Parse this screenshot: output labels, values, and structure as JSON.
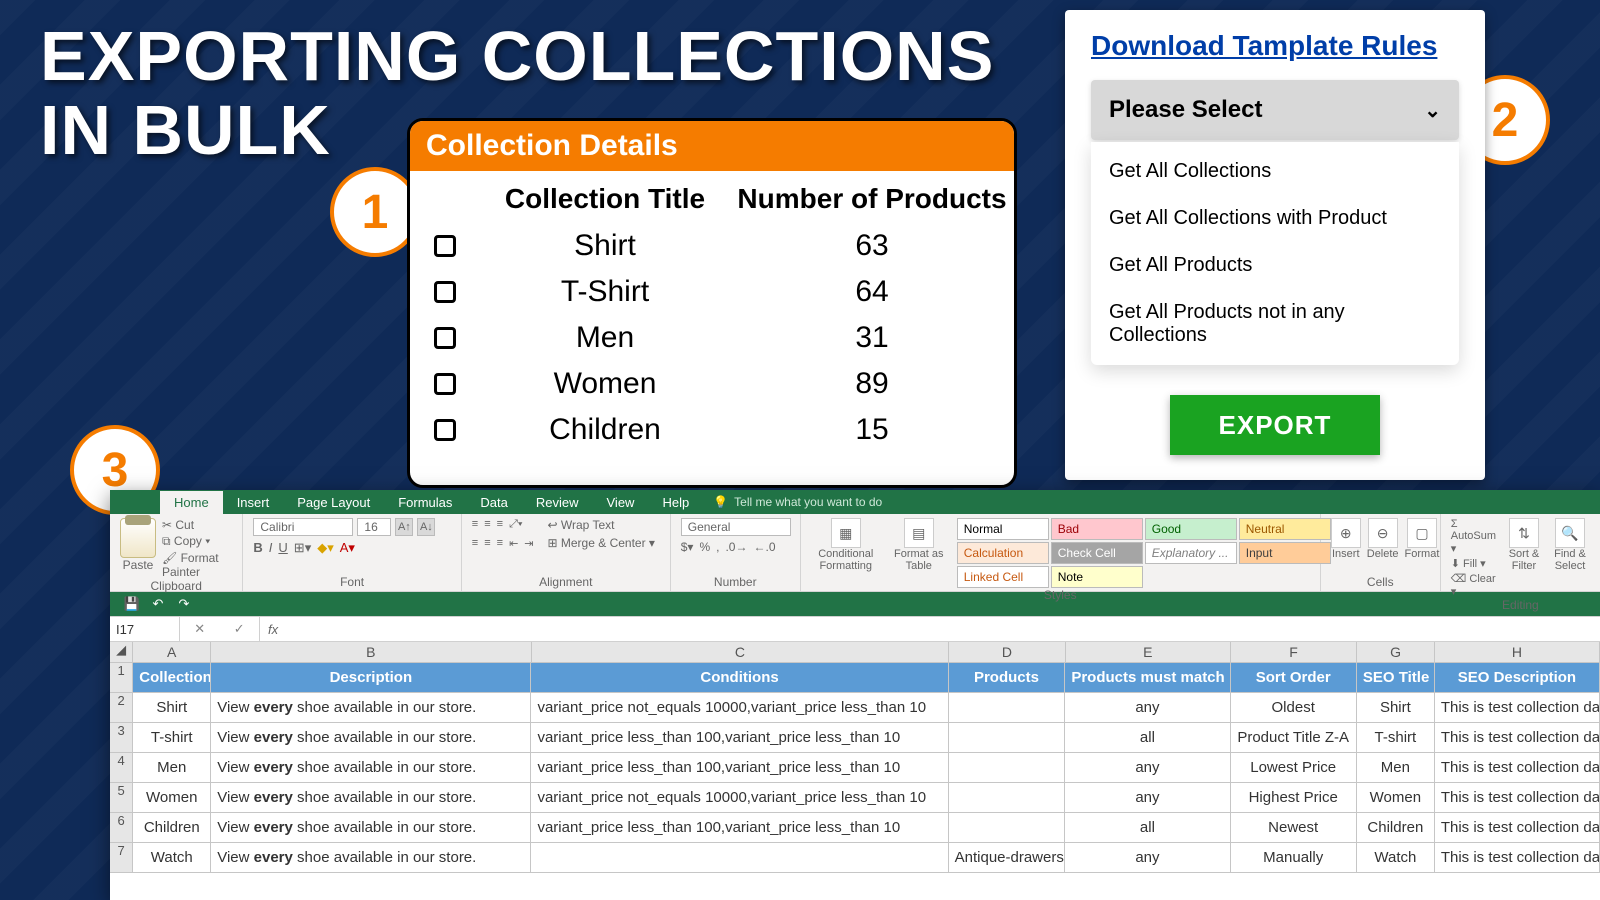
{
  "headline_l1": "EXPORTING COLLECTIONS",
  "headline_l2": "IN BULK",
  "badges": {
    "b1": "1",
    "b2": "2",
    "b3": "3"
  },
  "collection_card": {
    "title": "Collection Details",
    "col_title": "Collection Title",
    "col_count": "Number of Products",
    "rows": [
      {
        "title": "Shirt",
        "count": "63"
      },
      {
        "title": "T-Shirt",
        "count": "64"
      },
      {
        "title": "Men",
        "count": "31"
      },
      {
        "title": "Women",
        "count": "89"
      },
      {
        "title": "Children",
        "count": "15"
      }
    ]
  },
  "export_panel": {
    "download_link": "Download Tamplate Rules",
    "select_placeholder": "Please Select",
    "options": [
      "Get All Collections",
      "Get All Collections with Product",
      "Get All Products",
      "Get All Products not in any Collections"
    ],
    "export_label": "EXPORT"
  },
  "excel": {
    "tabs": [
      "Home",
      "Insert",
      "Page Layout",
      "Formulas",
      "Data",
      "Review",
      "View",
      "Help"
    ],
    "tell_me": "Tell me what you want to do",
    "clipboard_label": "Clipboard",
    "font_label": "Font",
    "alignment_label": "Alignment",
    "number_label": "Number",
    "styles_label": "Styles",
    "cells_label": "Cells",
    "editing_label": "Editing",
    "clip": {
      "cut": "Cut",
      "copy": "Copy",
      "painter": "Format Painter",
      "paste": "Paste"
    },
    "font": {
      "name": "Calibri",
      "size": "16"
    },
    "align": {
      "wrap": "Wrap Text",
      "merge": "Merge & Center"
    },
    "number_format": "General",
    "cond_fmt": "Conditional Formatting",
    "fmt_table": "Format as Table",
    "style_cells": [
      {
        "t": "Normal",
        "bg": "#ffffff",
        "fg": "#000"
      },
      {
        "t": "Bad",
        "bg": "#ffc7ce",
        "fg": "#9c0006"
      },
      {
        "t": "Good",
        "bg": "#c6efce",
        "fg": "#006100"
      },
      {
        "t": "Neutral",
        "bg": "#ffeb9c",
        "fg": "#9c5700"
      },
      {
        "t": "Calculation",
        "bg": "#fde9d9",
        "fg": "#c65911"
      },
      {
        "t": "Check Cell",
        "bg": "#a5a5a5",
        "fg": "#ffffff"
      },
      {
        "t": "Explanatory ...",
        "bg": "#ffffff",
        "fg": "#808080"
      },
      {
        "t": "Input",
        "bg": "#ffcc99",
        "fg": "#3f3f3f"
      },
      {
        "t": "Linked Cell",
        "bg": "#ffffff",
        "fg": "#c65911"
      },
      {
        "t": "Note",
        "bg": "#ffffcc",
        "fg": "#000000"
      }
    ],
    "cells_group": {
      "insert": "Insert",
      "delete": "Delete",
      "format": "Format"
    },
    "editing": {
      "autosum": "AutoSum",
      "fill": "Fill",
      "clear": "Clear",
      "sort": "Sort & Filter",
      "find": "Find & Select"
    },
    "namebox": "I17",
    "col_letters": [
      "A",
      "B",
      "C",
      "D",
      "E",
      "F",
      "G",
      "H"
    ],
    "headers": [
      "Collection",
      "Description",
      "Conditions",
      "Products",
      "Products must match",
      "Sort Order",
      "SEO Title",
      "SEO Description"
    ],
    "rows": [
      {
        "n": "2",
        "c": [
          "Shirt",
          "View <b>every</b> shoe available in our store.",
          "variant_price not_equals 10000,variant_price less_than 10",
          "",
          "any",
          "Oldest",
          "Shirt",
          "This is test collection  data"
        ]
      },
      {
        "n": "3",
        "c": [
          "T-shirt",
          "View <b>every</b> shoe available in our store.",
          "variant_price less_than 100,variant_price less_than 10",
          "",
          "all",
          "Product Title Z-A",
          "T-shirt",
          "This is test collection  data"
        ]
      },
      {
        "n": "4",
        "c": [
          "Men",
          "View <b>every</b> shoe available in our store.",
          "variant_price less_than 100,variant_price less_than 10",
          "",
          "any",
          "Lowest Price",
          "Men",
          "This is test collection  data"
        ]
      },
      {
        "n": "5",
        "c": [
          "Women",
          "View <b>every</b> shoe available in our store.",
          "variant_price not_equals 10000,variant_price less_than 10",
          "",
          "any",
          "Highest Price",
          "Women",
          "This is test collection  data"
        ]
      },
      {
        "n": "6",
        "c": [
          "Children",
          "View <b>every</b> shoe available in our store.",
          "variant_price less_than 100,variant_price less_than 10",
          "",
          "all",
          "Newest",
          "Children",
          "This is test collection  data"
        ]
      },
      {
        "n": "7",
        "c": [
          "Watch",
          "View <b>every</b> shoe available in our store.",
          "",
          "Antique-drawers",
          "any",
          "Manually",
          "Watch",
          "This is test collection  data"
        ]
      }
    ]
  }
}
